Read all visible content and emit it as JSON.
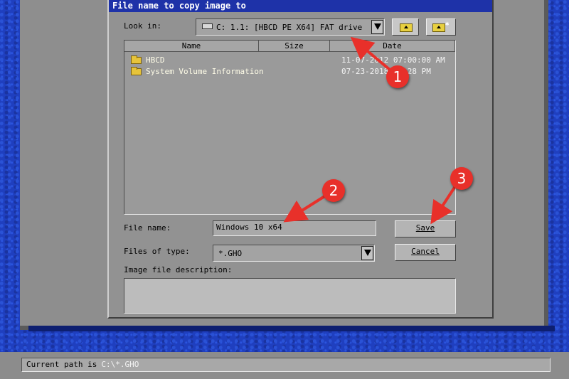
{
  "dialog": {
    "title": "File name to copy image to",
    "look_in": {
      "label": "Look in:",
      "value": "C: 1.1: [HBCD PE X64] FAT drive",
      "icon": "drive-icon"
    },
    "toolbar": {
      "up_icon": "up-folder-icon",
      "new_folder_icon": "new-folder-icon"
    },
    "file_list": {
      "columns": [
        "Name",
        "Size",
        "Date"
      ],
      "rows": [
        {
          "name": "HBCD",
          "size": "",
          "date": "11-07-2012 07:00:00 AM",
          "icon": "folder-icon"
        },
        {
          "name": "System Volume Information",
          "size": "",
          "date": "07-23-2018 03:28 PM",
          "icon": "folder-icon"
        }
      ]
    },
    "file_name": {
      "label": "File name:",
      "value": "Windows 10 x64"
    },
    "files_of_type": {
      "label": "Files of type:",
      "value": "*.GHO"
    },
    "description": {
      "label": "Image file description:",
      "value": ""
    },
    "buttons": {
      "save": "Save",
      "cancel": "Cancel"
    }
  },
  "status": {
    "label": "Current path is",
    "path": "C:\\*.GHO"
  },
  "callouts": [
    "1",
    "2",
    "3"
  ],
  "colors": {
    "title_bar": "#1e32a8",
    "dialog_bg": "#929292",
    "desktop": "#1f3fbf",
    "callout": "#e8302a"
  }
}
